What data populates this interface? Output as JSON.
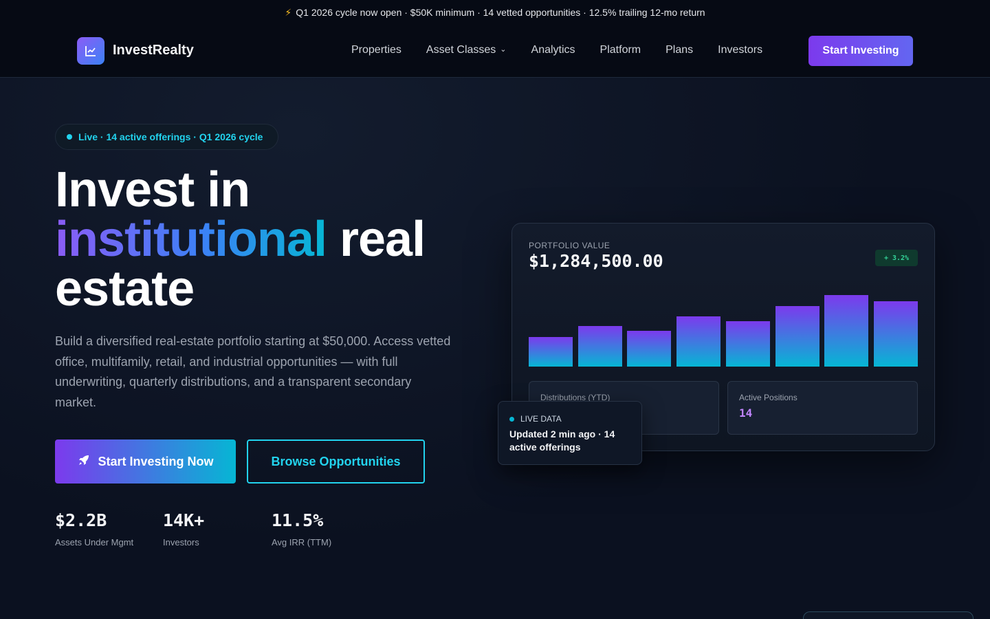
{
  "announcement": {
    "icon": "lightning-icon",
    "text": "Q1 2026 cycle now open · $50K minimum · 14 vetted opportunities · 12.5% trailing 12-mo return"
  },
  "nav": {
    "logo_icon": "chart-line-icon",
    "brand": "InvestRealty",
    "links": [
      {
        "label": "Properties"
      },
      {
        "label": "Asset Classes",
        "has_dropdown": true
      },
      {
        "label": "Analytics"
      },
      {
        "label": "Platform"
      },
      {
        "label": "Plans"
      },
      {
        "label": "Investors"
      }
    ],
    "cta": "Start Investing"
  },
  "hero": {
    "badge": "Live · 14 active offerings · Q1 2026 cycle",
    "headline": {
      "line1": "Invest in",
      "highlight": "institutional",
      "rest": " real",
      "line3": "estate"
    },
    "subtitle": "Build a diversified real-estate portfolio starting at $50,000. Access vetted office, multifamily, retail, and industrial opportunities — with full underwriting, quarterly distributions, and a transparent secondary market.",
    "primary_cta": "Start Investing Now",
    "primary_cta_icon": "rocket-icon",
    "secondary_cta": "Browse Opportunities",
    "stats": [
      {
        "value": "$2.2B",
        "label": "Assets Under Mgmt"
      },
      {
        "value": "14K+",
        "label": "Investors"
      },
      {
        "value": "11.5%",
        "label": "Avg IRR (TTM)"
      }
    ]
  },
  "portfolio_card": {
    "label": "PORTFOLIO VALUE",
    "value": "$1,284,500.00",
    "change": "+ 3.2%",
    "tiles": [
      {
        "label": "Distributions (YTD)",
        "value": ""
      },
      {
        "label": "Active Positions",
        "value": "14"
      }
    ]
  },
  "live_card": {
    "label": "LIVE DATA",
    "text": "Updated 2 min ago · 14 active offerings"
  },
  "colors": {
    "background": "#0b1120",
    "accent_purple": "#7c3aed",
    "accent_cyan": "#22d3ee",
    "positive_green": "#34d399"
  },
  "chart_data": {
    "type": "bar",
    "title": "",
    "xlabel": "",
    "ylabel": "",
    "values": [
      41,
      57,
      50,
      70,
      63,
      85,
      100,
      91
    ],
    "ylim": [
      0,
      100
    ],
    "grid": false
  }
}
